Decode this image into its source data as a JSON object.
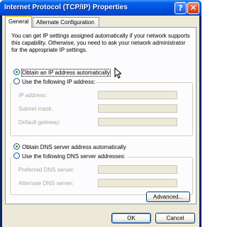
{
  "window": {
    "title": "Internet Protocol (TCP/IP) Properties",
    "help_label": "?",
    "close_label": "✕"
  },
  "tabs": [
    {
      "label": "General",
      "selected": true
    },
    {
      "label": "Alternate Configuration",
      "selected": false
    }
  ],
  "description": "You can get IP settings assigned automatically if your network supports this capability. Otherwise, you need to ask your network administrator for the appropriate IP settings.",
  "ip": {
    "auto_label": "Obtain an IP address automatically",
    "auto_selected": true,
    "manual_label": "Use the following IP address:",
    "fields": [
      {
        "label": "IP address:",
        "value": ""
      },
      {
        "label": "Subnet mask:",
        "value": ""
      },
      {
        "label": "Default gateway:",
        "value": ""
      }
    ]
  },
  "dns": {
    "auto_label": "Obtain DNS server address automatically",
    "auto_selected": true,
    "manual_label": "Use the following DNS server addresses:",
    "fields": [
      {
        "label": "Preferred DNS server:",
        "value": ""
      },
      {
        "label": "Alternate DNS server:",
        "value": ""
      }
    ]
  },
  "buttons": {
    "advanced": "Advanced...",
    "ok": "OK",
    "cancel": "Cancel"
  },
  "colors": {
    "title_bar": "#0054e3",
    "dialog_bg": "#ece9d8",
    "radio_selected": "#21a121"
  }
}
